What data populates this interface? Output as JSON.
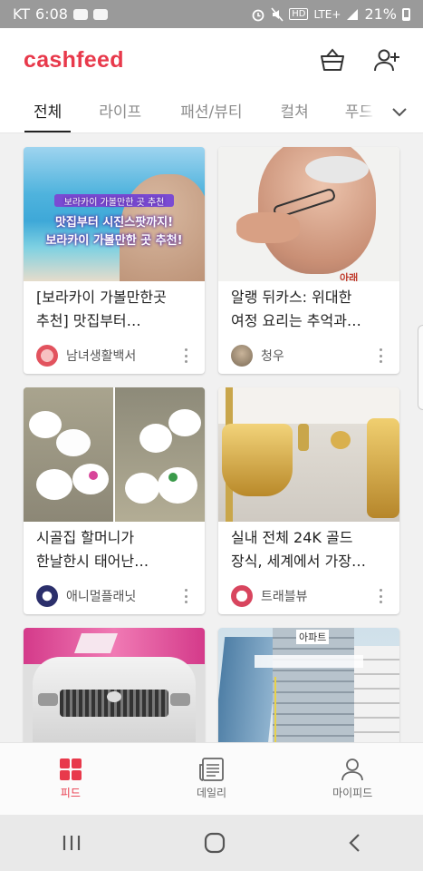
{
  "status_bar": {
    "carrier": "KT",
    "time": "6:08",
    "network": "LTE+",
    "battery": "21%"
  },
  "app": {
    "logo": "cashfeed"
  },
  "tabs": [
    {
      "label": "전체",
      "active": true
    },
    {
      "label": "라이프",
      "active": false
    },
    {
      "label": "패션/뷰티",
      "active": false
    },
    {
      "label": "컬쳐",
      "active": false
    },
    {
      "label": "푸드",
      "active": false
    }
  ],
  "cards": [
    {
      "title_line1": "[보라카이 가볼만한곳",
      "title_line2": "추천] 맛집부터…",
      "source": "남녀생활백서",
      "overlay_small": "보라카이 가볼만한 곳 추천",
      "overlay_line1": "맛집부터 시진스팟까지!",
      "overlay_line2": "보라카이 가볼만한 곳 추천!"
    },
    {
      "title_line1": "알랭 뒤카스: 위대한",
      "title_line2": "여정 요리는 추억과…",
      "source": "청우",
      "thumb_text": "아래"
    },
    {
      "title_line1": "시골집 할머니가",
      "title_line2": "한날한시 태어난…",
      "source": "애니멀플래닛"
    },
    {
      "title_line1": "실내 전체 24K 골드",
      "title_line2": "장식, 세계에서 가장…",
      "source": "트래블뷰"
    },
    {
      "title_line1": "",
      "title_line2": "",
      "source": ""
    },
    {
      "title_line1": "",
      "title_line2": "",
      "source": "",
      "thumb_text": "아파트"
    }
  ],
  "bottom_nav": [
    {
      "label": "피드",
      "icon": "grid-icon",
      "active": true
    },
    {
      "label": "데일리",
      "icon": "news-icon",
      "active": false
    },
    {
      "label": "마이피드",
      "icon": "person-icon",
      "active": false
    }
  ],
  "colors": {
    "brand": "#e8394b",
    "text": "#222222",
    "muted": "#8d8d8d"
  }
}
